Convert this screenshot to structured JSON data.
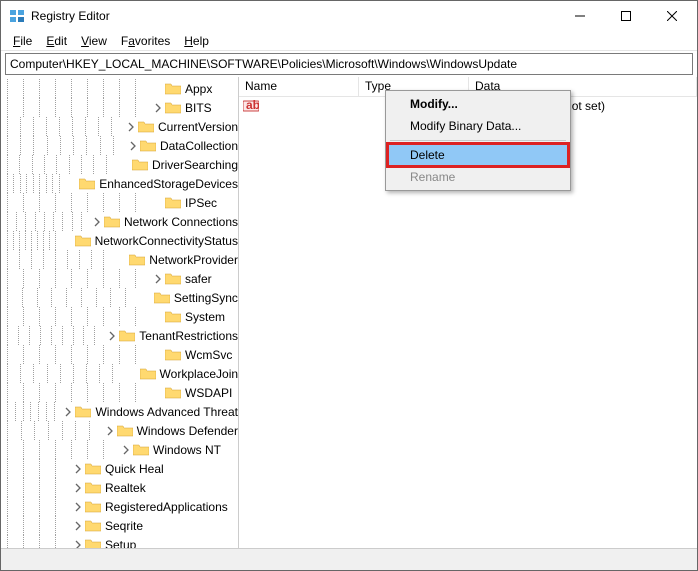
{
  "window": {
    "title": "Registry Editor"
  },
  "menubar": {
    "file": "File",
    "edit": "Edit",
    "view": "View",
    "favorites": "Favorites",
    "help": "Help"
  },
  "address": "Computer\\HKEY_LOCAL_MACHINE\\SOFTWARE\\Policies\\Microsoft\\Windows\\WindowsUpdate",
  "tree": [
    {
      "depth": 9,
      "exp": "",
      "label": "Appx"
    },
    {
      "depth": 9,
      "exp": "closed",
      "label": "BITS"
    },
    {
      "depth": 9,
      "exp": "closed",
      "label": "CurrentVersion"
    },
    {
      "depth": 9,
      "exp": "closed",
      "label": "DataCollection"
    },
    {
      "depth": 9,
      "exp": "",
      "label": "DriverSearching"
    },
    {
      "depth": 9,
      "exp": "",
      "label": "EnhancedStorageDevices"
    },
    {
      "depth": 9,
      "exp": "",
      "label": "IPSec"
    },
    {
      "depth": 9,
      "exp": "closed",
      "label": "Network Connections"
    },
    {
      "depth": 9,
      "exp": "",
      "label": "NetworkConnectivityStatus"
    },
    {
      "depth": 9,
      "exp": "",
      "label": "NetworkProvider"
    },
    {
      "depth": 9,
      "exp": "closed",
      "label": "safer"
    },
    {
      "depth": 9,
      "exp": "",
      "label": "SettingSync"
    },
    {
      "depth": 9,
      "exp": "",
      "label": "System"
    },
    {
      "depth": 9,
      "exp": "closed",
      "label": "TenantRestrictions"
    },
    {
      "depth": 9,
      "exp": "",
      "label": "WcmSvc"
    },
    {
      "depth": 9,
      "exp": "",
      "label": "WorkplaceJoin"
    },
    {
      "depth": 9,
      "exp": "",
      "label": "WSDAPI"
    },
    {
      "depth": 7,
      "exp": "closed",
      "label": "Windows Advanced Threat"
    },
    {
      "depth": 7,
      "exp": "closed",
      "label": "Windows Defender"
    },
    {
      "depth": 7,
      "exp": "closed",
      "label": "Windows NT"
    },
    {
      "depth": 4,
      "exp": "closed",
      "label": "Quick Heal"
    },
    {
      "depth": 4,
      "exp": "closed",
      "label": "Realtek"
    },
    {
      "depth": 4,
      "exp": "closed",
      "label": "RegisteredApplications"
    },
    {
      "depth": 4,
      "exp": "closed",
      "label": "Seqrite"
    },
    {
      "depth": 4,
      "exp": "closed",
      "label": "Setup"
    }
  ],
  "list": {
    "headers": {
      "name": "Name",
      "type": "Type",
      "data": "Data"
    },
    "rows": [
      {
        "name": "",
        "type": "",
        "data": "(value not set)"
      }
    ]
  },
  "context": {
    "modify": "Modify...",
    "modify_binary": "Modify Binary Data...",
    "delete": "Delete",
    "rename": "Rename"
  }
}
